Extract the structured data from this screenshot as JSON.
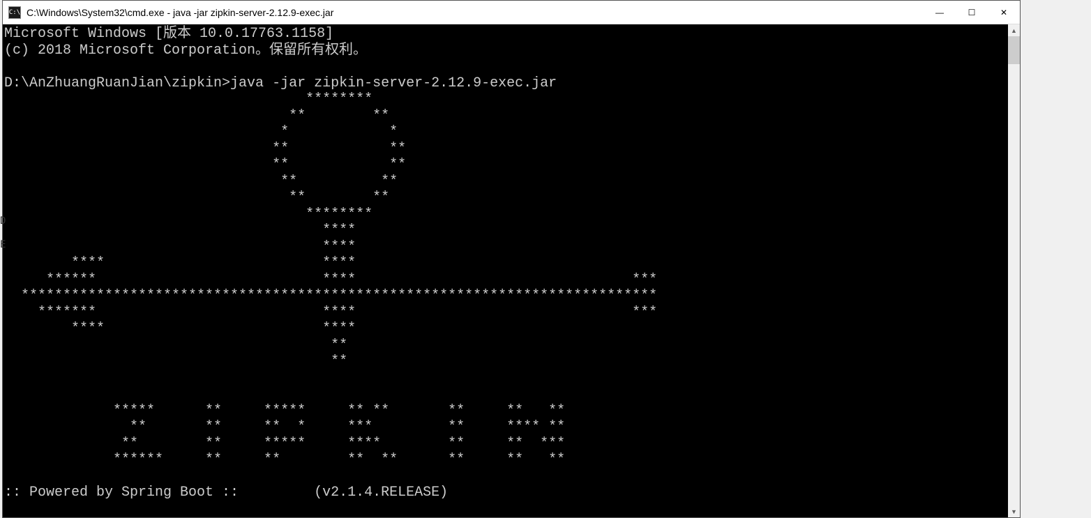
{
  "window": {
    "icon_label": "C:\\",
    "title": "C:\\Windows\\System32\\cmd.exe - java  -jar zipkin-server-2.12.9-exec.jar"
  },
  "controls": {
    "minimize": "—",
    "maximize": "☐",
    "close": "✕"
  },
  "scrollbar": {
    "up": "▲",
    "down": "▼"
  },
  "side": {
    "letter1": "D",
    "letter2": "E"
  },
  "terminal_lines": [
    "Microsoft Windows [版本 10.0.17763.1158]",
    "(c) 2018 Microsoft Corporation。保留所有权利。",
    "",
    "D:\\AnZhuangRuanJian\\zipkin>java -jar zipkin-server-2.12.9-exec.jar",
    "                                    ********",
    "                                  **        **",
    "                                 *            *",
    "                                **            **",
    "                                **            **",
    "                                 **          **",
    "                                  **        **",
    "                                    ********",
    "                                      ****",
    "                                      ****",
    "        ****                          ****",
    "     ******                           ****                                 ***",
    "  ****************************************************************************",
    "    *******                           ****                                 ***",
    "        ****                          ****",
    "                                       **",
    "                                       **",
    "",
    "",
    "             *****      **     *****     ** **       **     **   **",
    "               **       **     **  *     ***         **     **** **",
    "              **        **     *****     ****        **     **  ***",
    "             ******     **     **        **  **      **     **   **",
    "",
    ":: Powered by Spring Boot ::         (v2.1.4.RELEASE)"
  ]
}
